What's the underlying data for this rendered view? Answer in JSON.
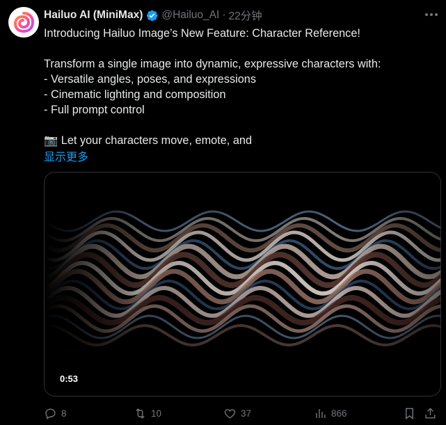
{
  "tweet": {
    "author_name": "Hailuo AI (MiniMax)",
    "handle": "@Hailuo_AI",
    "separator": "·",
    "time": "22分钟",
    "lines": [
      "Introducing Hailuo Image’s New Feature: Character Reference!",
      "",
      "Transform a single image into dynamic, expressive characters with:",
      "- Versatile angles, poses, and expressions",
      "- Cinematic lighting and composition",
      "- Full prompt control",
      "",
      "📷 Let your characters move, emote, and"
    ],
    "show_more": "显示更多",
    "video": {
      "duration": "0:53"
    }
  },
  "actions": {
    "replies": "8",
    "reposts": "10",
    "likes": "37",
    "views": "866"
  },
  "colors": {
    "accent": "#1d9bf0",
    "text": "#e7e9ea",
    "muted": "#71767b",
    "background": "#000000"
  },
  "icons": [
    "more-icon",
    "verified-badge-icon",
    "reply-icon",
    "repost-icon",
    "like-icon",
    "views-icon",
    "bookmark-icon",
    "share-icon"
  ]
}
